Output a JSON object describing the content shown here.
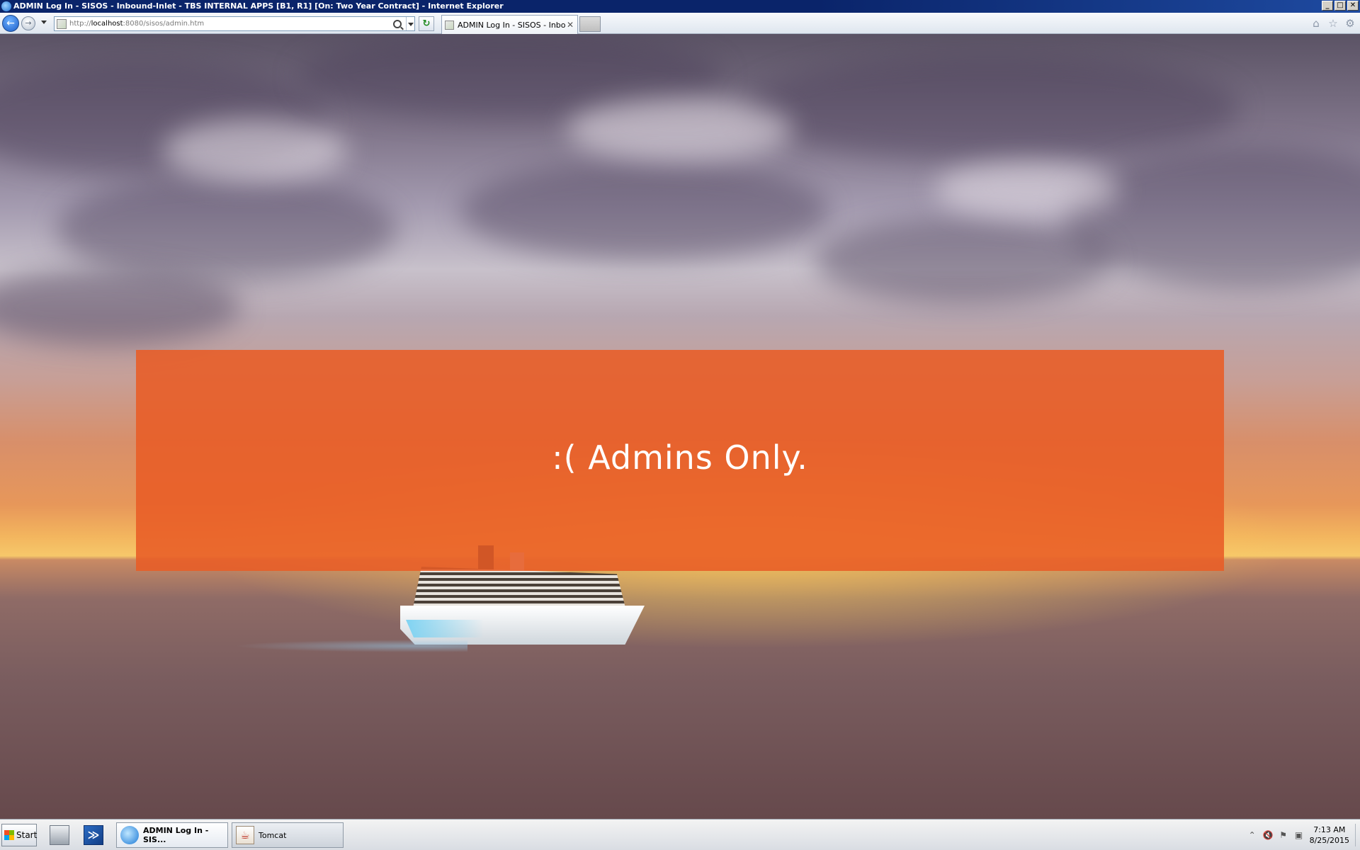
{
  "window": {
    "title": "ADMIN Log In - SISOS - Inbound-Inlet - TBS INTERNAL APPS [B1, R1] [On: Two Year Contract] - Internet Explorer",
    "controls": {
      "minimize": "_",
      "maximize": "□",
      "close": "✕"
    }
  },
  "browser": {
    "url_prefix": "http://",
    "url_host": "localhost",
    "url_rest": ":8080/sisos/admin.htm",
    "tab_label": "ADMIN Log In - SISOS - Inbo...",
    "tab_close": "✕",
    "back_glyph": "←",
    "forward_glyph": "→",
    "refresh_glyph": "↻",
    "right_icons": [
      "home-icon",
      "favorites-star-icon",
      "tools-gear-icon"
    ],
    "home_glyph": "⌂",
    "star_glyph": "☆",
    "gear_glyph": "⚙"
  },
  "page": {
    "banner_text": ":( Admins Only.",
    "banner_color": "#e85c26"
  },
  "taskbar": {
    "start_label": "Start",
    "powershell_glyph": "≫",
    "tasks": [
      {
        "label": "ADMIN Log In - SIS...",
        "icon": "internet-explorer-icon",
        "active": true
      },
      {
        "label": "Tomcat",
        "icon": "java-icon",
        "active": false
      }
    ],
    "java_glyph": "☕",
    "tray": {
      "up_glyph": "⌃",
      "volume_glyph": "🔇",
      "flag_glyph": "⚑",
      "network_glyph": "▣",
      "time": "7:13 AM",
      "date": "8/25/2015"
    }
  }
}
